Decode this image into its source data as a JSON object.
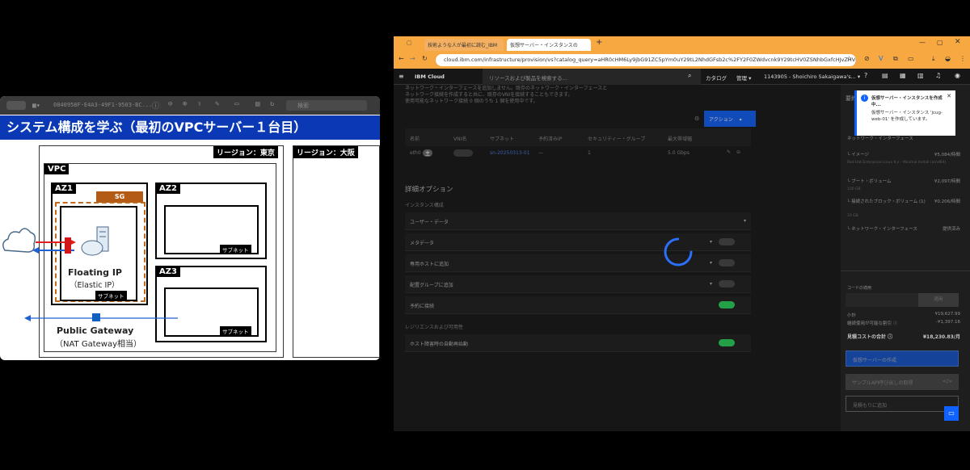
{
  "slide": {
    "toolbar_title": "0840958F-E4A3-49F1-9503-BC...",
    "search_placeholder": "検索",
    "title": "システム構成を学ぶ（最初のVPCサーバー１台目）",
    "region_tokyo": "リージョン：東京",
    "region_osaka": "リージョン：大阪",
    "vpc": "VPC",
    "az1": "AZ1",
    "az2": "AZ2",
    "az3": "AZ3",
    "sg": "SG",
    "subnet": "サブネット",
    "floating_ip": "Floating IP",
    "elastic_ip": "（Elastic IP）",
    "public_gateway": "Public Gateway",
    "nat_gateway": "（NAT Gateway相当）"
  },
  "browser": {
    "tabs": [
      "技術ような人が最初に読む_IBM",
      "仮想サーバー・インスタンスの"
    ],
    "url": "cloud.ibm.com/infrastructure/provision/vs?catalog_query=aHR0cHM6Ly9jbG91ZC5pYm0uY29tL2NhdGFsb2c%2FY2F0ZWdvcnk9Y29tcHV0ZSNhbGxfcHJvZHVjdHM%..."
  },
  "ibm": {
    "brand": "IBM Cloud",
    "search_placeholder": "リソースおよび製品を検索する...",
    "catalog": "カタログ",
    "manage": "管理",
    "account": "1143905 - Shoichiro Sakaigawa's..."
  },
  "main": {
    "intro": [
      "ネットワーク・インターフェースを追加しません。既存のネットワーク・インターフェースと",
      "ネットワーク接続を作成すると共に、既存のVNIを接続することもできます。",
      "使用可能なネットワーク接続 0 個のうち 1 個を使用中です。"
    ],
    "action_button": "アクション",
    "table_headers": [
      "名前",
      "VNI名",
      "サブネット",
      "予約済みIP",
      "セキュリティー・グループ",
      "最大帯域幅"
    ],
    "table_row": {
      "name": "eth0",
      "badge": "主",
      "vni": "",
      "subnet": "sn-20250313-01",
      "reserved_ip": "—",
      "sg": "1",
      "bandwidth": "5.0 Gbps"
    },
    "advanced_title": "詳細オプション",
    "instance_label": "インスタンス構成",
    "user_data": "ユーザー・データ",
    "options": [
      {
        "label": "メタデータ",
        "on": false
      },
      {
        "label": "専用ホストに追加",
        "on": false
      },
      {
        "label": "配置グループに追加",
        "on": false
      },
      {
        "label": "予約に接続",
        "on": true
      }
    ],
    "resilience_label": "レジリエンスおよび可用性",
    "auto_restart": {
      "label": "ホスト障害時の自動再始動",
      "on": true
    }
  },
  "summary": {
    "heading": "要約",
    "lines": [
      {
        "label": "ネットワーク・インターフェース",
        "value": ""
      },
      {
        "label": "イメージ",
        "value": "¥5,084/時間"
      },
      {
        "label": "Red Hat Enterprise Linux 9.x - Minimal Install (amd64)",
        "value": ""
      },
      {
        "label": "ブート・ボリューム",
        "value": "¥2,097/時間"
      },
      {
        "label": "100 GB",
        "value": ""
      },
      {
        "label": "接続されたブロック・ボリューム (1)",
        "value": "¥0.206/時間"
      },
      {
        "label": "10 GB",
        "value": ""
      },
      {
        "label": "ネットワーク・インターフェース",
        "value": "提供済み"
      }
    ],
    "code_label": "コードの適用",
    "apply": "適用",
    "subtotal_label": "小計",
    "subtotal_value": "¥19,627.99",
    "discount_label": "継続使用が可能な割引",
    "discount_value": "-¥1,397.16",
    "total_label": "見積コストの合計",
    "total_value": "¥18,230.83/月",
    "create_button": "仮想サーバーの作成",
    "api_button": "サンプルAPI呼び出しの取得",
    "estimate_button": "見積もりに追加"
  },
  "toast": {
    "title": "仮想サーバー・インスタンスを作成中...",
    "body": "仮想サーバー・インスタンス 'jcug-web-01' を作成しています。"
  }
}
